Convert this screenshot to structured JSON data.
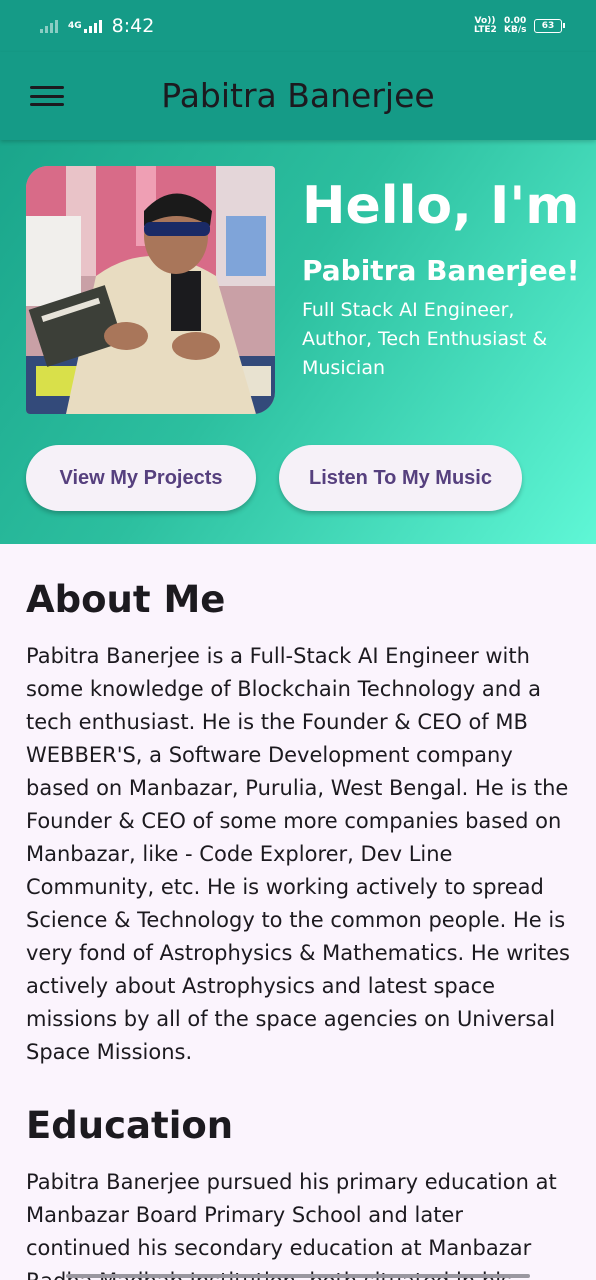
{
  "status_bar": {
    "network_type": "4G",
    "time": "8:42",
    "volte": "Vo)) LTE2",
    "speed": "0.00 KB/s",
    "battery": "63"
  },
  "app_bar": {
    "title": "Pabitra Banerjee",
    "menu_icon": "hamburger-menu-icon"
  },
  "hero": {
    "greeting": "Hello, I'm",
    "name": "Pabitra Banerjee!",
    "tagline": "Full Stack AI Engineer, Author, Tech Enthusiast & Musician",
    "buttons": {
      "projects": "View My Projects",
      "music": "Listen To My Music"
    }
  },
  "about": {
    "heading": "About Me",
    "body": "Pabitra Banerjee is a Full-Stack AI Engineer with some knowledge of Blockchain Technology and a tech enthusiast. He is the Founder & CEO of MB WEBBER'S, a Software Development company based on Manbazar, Purulia, West Bengal. He is the Founder & CEO of some more companies based on Manbazar, like - Code Explorer, Dev Line Community, etc. He is working actively to spread Science & Technology to the common people. He is very fond of Astrophysics & Mathematics. He writes actively about Astrophysics and latest space missions by all of the space agencies on Universal Space Missions."
  },
  "education": {
    "heading": "Education",
    "body": "Pabitra Banerjee pursued his primary education at Manbazar Board Primary School and later continued his secondary education at Manbazar Radha Madhab Institution, both situated in his"
  },
  "colors": {
    "app_bar": "#159b87",
    "hero_gradient_start": "#1aa58b",
    "hero_gradient_end": "#5ff7d6",
    "button_text": "#56407e",
    "page_background": "#fbf4fd"
  }
}
